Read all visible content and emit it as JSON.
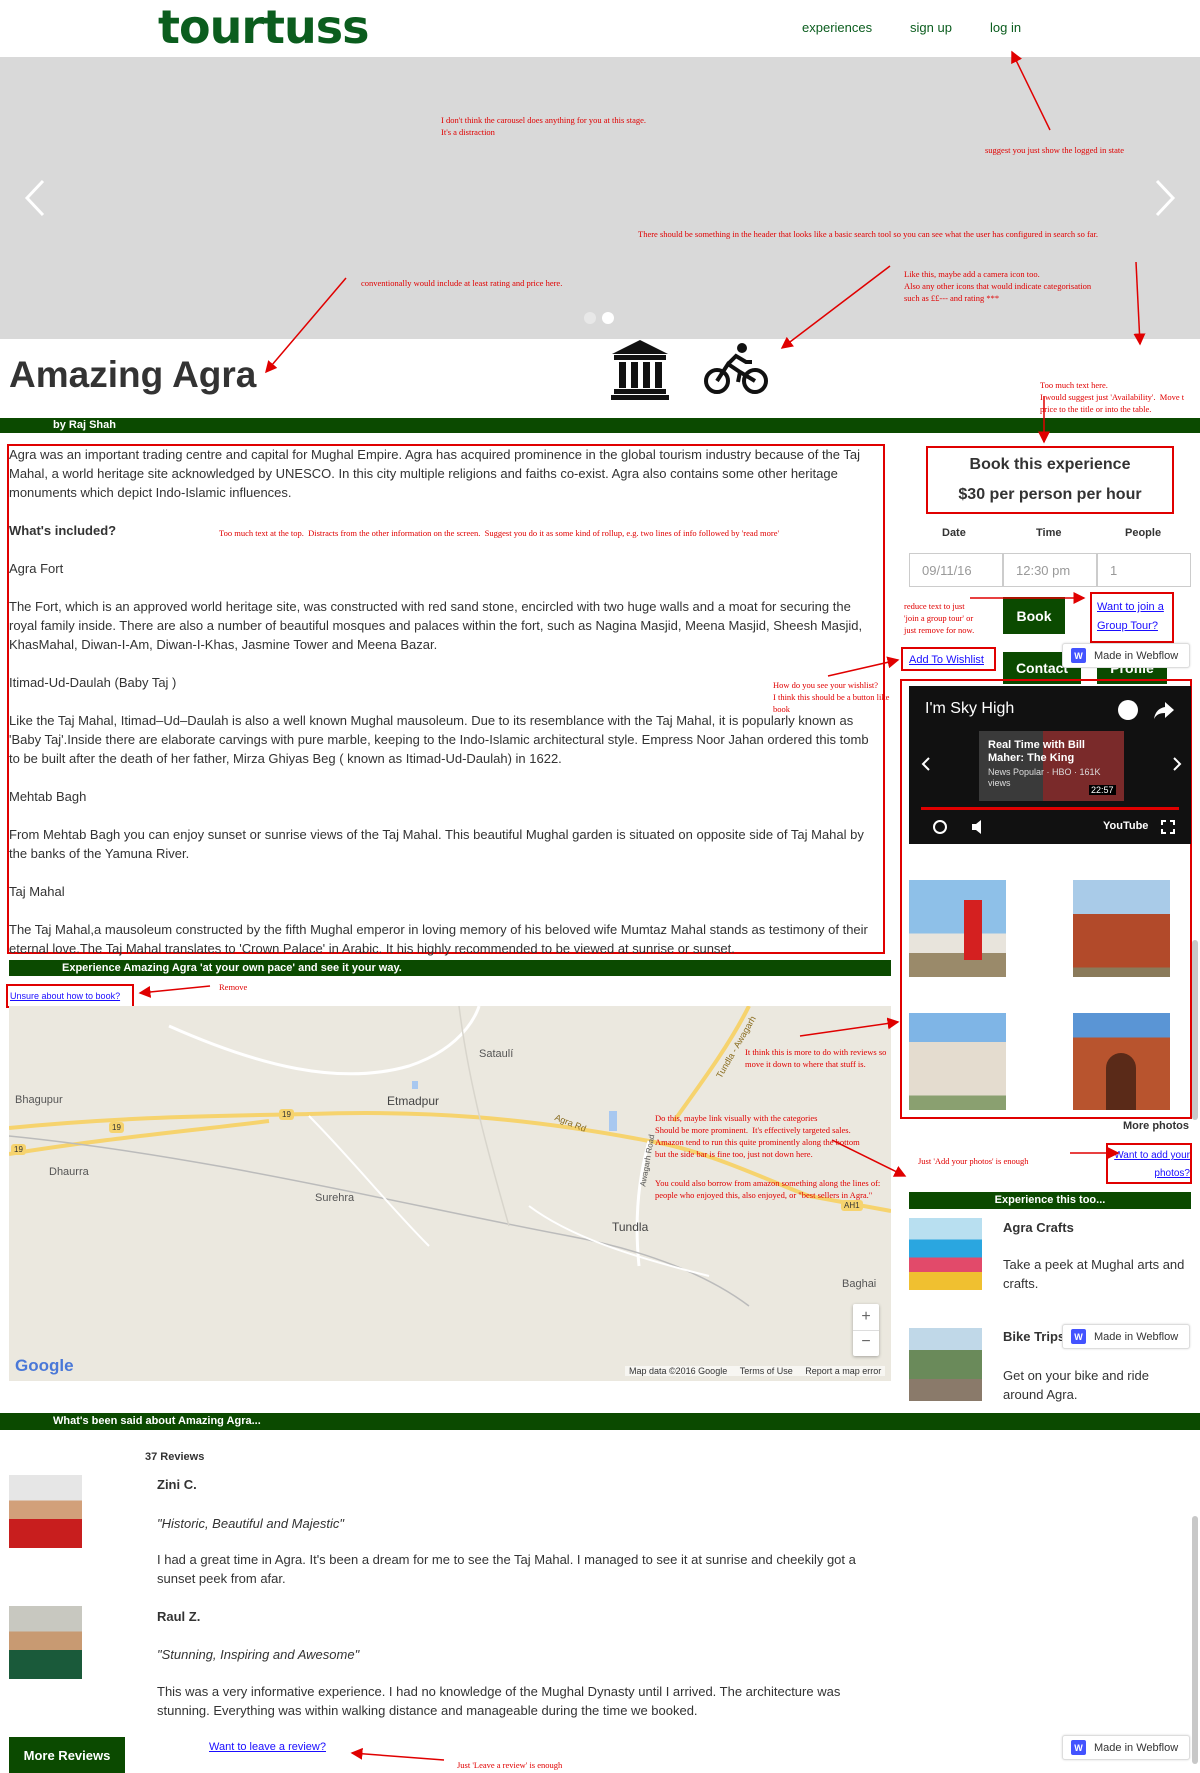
{
  "colors": {
    "brand": "#0b5d1e",
    "bar": "#0b4a00",
    "annotation": "#e00000",
    "link": "#1a0dff"
  },
  "header": {
    "logo": "tourtuss",
    "nav": [
      "experiences",
      "sign up",
      "log in"
    ]
  },
  "carousel": {
    "slides": 2,
    "active": 1
  },
  "notes": {
    "carousel": "I don't think the carousel does anything for you at this stage.\nIt's a distraction",
    "logged": "suggest you just show the logged in state",
    "search": "There should be something in the header that looks like a basic search tool so you can see what the user has configured in search so far.",
    "rating": "conventionally would include at least rating and price here.",
    "camera": "Like this, maybe add a camera icon too.\nAlso any other icons that would indicate categorisation\nsuch as ££--- and rating ***",
    "text_here": "Too much text here.\nI would suggest just 'Availability'.  Move t\nprice to the title or into the table.",
    "top_text": "Too much text at the top.  Distracts from the other information on the screen.  Suggest you do it as some kind of rollup, e.g. two lines of info followed by 'read more'",
    "reduce": "reduce text to just\n'join a group tour' or\njust remove for now.",
    "wishlist": "How do you see your wishlist?\nI think this should be a button like\nbook",
    "remove": "Remove",
    "reviews_move": "It think this is more to do with reviews so\nmove it down to where that stuff is.",
    "link_visual": "Do this, maybe link visually with the categories\nShould be more prominent.  It's effectively targeted sales.\nAmazon tend to run this quite prominently along the bottom\nbut the side bar is fine too, just not down here.",
    "amazon": "You could also borrow from amazon something along the lines of:\npeople who enjoyed this, also enjoyed, or \"best sellers in Agra.\"",
    "add_photos": "Just 'Add your photos' is enough",
    "leave_review": "Just 'Leave a review' is enough"
  },
  "experience": {
    "title": "Amazing Agra",
    "author": "by Raj Shah",
    "intro": "Agra was an important trading centre and capital for Mughal Empire. Agra has acquired prominence in the global tourism industry because of the Taj Mahal, a world heritage site acknowledged by UNESCO. In this city multiple religions and faiths co-exist. Agra also contains some other heritage monuments which depict Indo-Islamic influences.",
    "included_heading": "What's included?",
    "sections": [
      {
        "name": "Agra Fort",
        "text": "The Fort, which is an approved world heritage site, was constructed with red sand stone, encircled with two huge walls and a moat for securing the royal family inside. There are also a number of beautiful mosques and palaces within the fort, such as Nagina Masjid, Meena Masjid, Sheesh Masjid, KhasMahal, Diwan-I-Am, Diwan-I-Khas, Jasmine Tower and Meena Bazar."
      },
      {
        "name": "Itimad-Ud-Daulah (Baby Taj )",
        "text": "Like the Taj Mahal, Itimad–Ud–Daulah is also a well known Mughal mausoleum. Due to its resemblance with the Taj Mahal, it is popularly known as 'Baby Taj'.Inside there are elaborate carvings with pure marble, keeping to the Indo-Islamic architectural style. Empress Noor Jahan ordered this tomb to be built after the death of her father, Mirza Ghiyas Beg ( known as Itimad-Ud-Daulah) in 1622."
      },
      {
        "name": "Mehtab Bagh",
        "text": "From Mehtab Bagh you can enjoy sunset or sunrise views of the Taj Mahal. This beautiful Mughal garden is situated on opposite side of Taj Mahal by the banks of the Yamuna River."
      },
      {
        "name": "Taj Mahal",
        "text": "The Taj Mahal,a mausoleum constructed by the fifth Mughal emperor in loving memory of his beloved wife Mumtaz Mahal stands as testimony of their eternal love.The Taj Mahal translates to 'Crown Palace' in Arabic. It his highly recommended to be viewed at sunrise or sunset."
      }
    ],
    "own_pace_bar": "Experience Amazing Agra 'at your own pace' and see it your way.",
    "unsure_link": "Unsure about how to book?"
  },
  "booking": {
    "title": "Book this experience",
    "price": "$30 per person per hour",
    "labels": {
      "date": "Date",
      "time": "Time",
      "people": "People"
    },
    "values": {
      "date": "09/11/16",
      "time": "12:30 pm",
      "people": "1"
    },
    "book": "Book",
    "group_tour": "Want to join a\nGroup Tour?",
    "wishlist": "Add To Wishlist",
    "contact": "Contact",
    "profile": "Profile"
  },
  "webflow": "Made in Webflow",
  "video": {
    "title": "I'm Sky High",
    "card_title": "Real Time with Bill Maher: The King",
    "card_sub": "News Popular · HBO · 161K views",
    "duration": "22:57",
    "youtube": "YouTube"
  },
  "photos": {
    "more": "More photos",
    "add": "Want to add your\nphotos?"
  },
  "also": {
    "bar": "Experience this too...",
    "items": [
      {
        "title": "Agra Crafts",
        "text": "Take a peek at Mughal arts and crafts."
      },
      {
        "title": "Bike Trips",
        "text": "Get on your bike and ride around Agra."
      }
    ]
  },
  "map": {
    "places": [
      "Sataulí",
      "Bhagupur",
      "Etmadpur",
      "Dhaurra",
      "Surehra",
      "Tundla",
      "Baghai",
      "Tundla - Awagarh",
      "Agra Rd",
      "Awagarh Road"
    ],
    "footer": {
      "data": "Map data ©2016 Google",
      "terms": "Terms of Use",
      "report": "Report a map error"
    },
    "google": "Google",
    "road_numbers": [
      "19",
      "19",
      "19",
      "AH1"
    ]
  },
  "reviews": {
    "bar": "What's been said about Amazing Agra...",
    "count": "37 Reviews",
    "items": [
      {
        "name": "Zini C.",
        "quote": "\"Historic, Beautiful and Majestic\"",
        "text": "I had a great time in Agra. It's been a dream for me to see the Taj Mahal. I managed to see it at sunrise and cheekily got a sunset peek from afar."
      },
      {
        "name": "Raul Z.",
        "quote": "\"Stunning, Inspiring and Awesome\"",
        "text": "This was a very informative experience. I had no knowledge of the Mughal Dynasty until I arrived. The architecture was stunning. Everything was within walking distance and manageable during the time we booked."
      }
    ],
    "more": "More Reviews",
    "leave": "Want to leave a review?"
  }
}
